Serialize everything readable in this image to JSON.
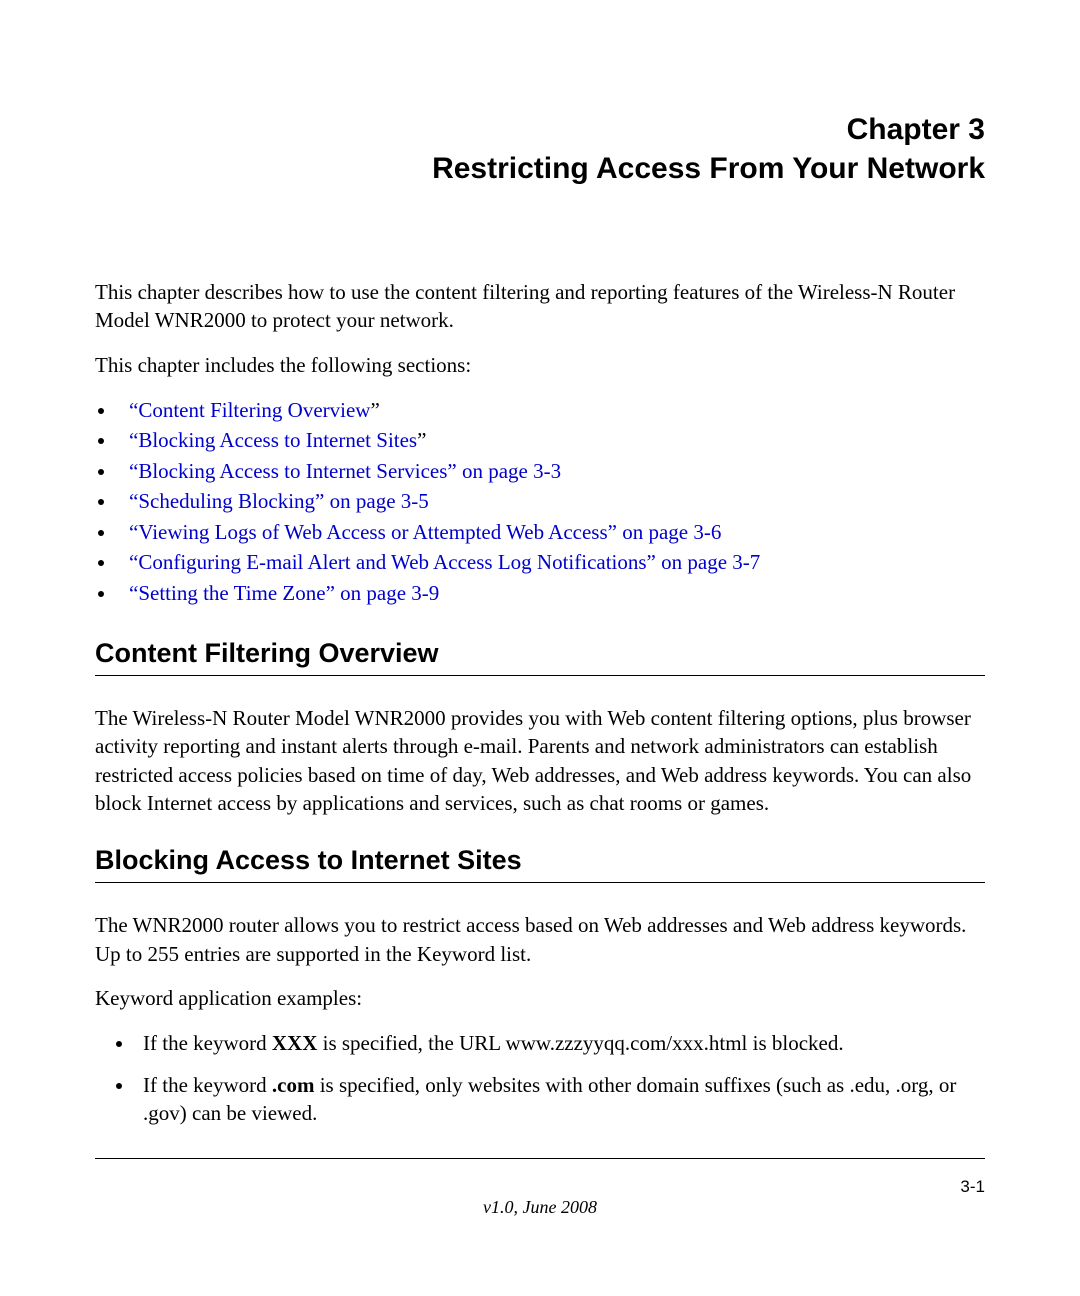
{
  "chapter": {
    "line1": "Chapter 3",
    "line2": "Restricting Access From Your Network"
  },
  "intro": {
    "p1": "This chapter describes how to use the content filtering and reporting features of the Wireless-N Router Model WNR2000 to protect your network.",
    "p2": "This chapter includes the following sections:"
  },
  "toc": [
    {
      "link": "“Content Filtering Overview",
      "tail": "”"
    },
    {
      "link": "“Blocking Access to Internet Sites",
      "tail": "”"
    },
    {
      "link": "“Blocking Access to Internet Services” on page 3-3",
      "tail": ""
    },
    {
      "link": "“Scheduling Blocking” on page 3-5",
      "tail": ""
    },
    {
      "link": "“Viewing Logs of Web Access or Attempted Web Access” on page 3-6",
      "tail": ""
    },
    {
      "link": "“Configuring E-mail Alert and Web Access Log Notifications” on page 3-7",
      "tail": ""
    },
    {
      "link": "“Setting the Time Zone” on page 3-9",
      "tail": ""
    }
  ],
  "section1": {
    "heading": "Content Filtering Overview",
    "body": "The Wireless-N Router Model WNR2000 provides you with Web content filtering options, plus browser activity reporting and instant alerts through e-mail. Parents and network administrators can establish restricted access policies based on time of day, Web addresses, and Web address keywords. You can also block Internet access by applications and services, such as chat rooms or games."
  },
  "section2": {
    "heading": "Blocking Access to Internet Sites",
    "body1": "The WNR2000 router allows you to restrict access based on Web addresses and Web address keywords. Up to 255 entries are supported in the Keyword list.",
    "body2": "Keyword application examples:",
    "bullets": [
      {
        "pre": "If the keyword ",
        "bold": "XXX",
        "post": " is specified, the URL www.zzzyyqq.com/xxx.html is blocked."
      },
      {
        "pre": "If the keyword ",
        "bold": ".com",
        "post": " is specified, only websites with other domain suffixes (such as .edu, .org, or .gov) can be viewed."
      }
    ]
  },
  "footer": {
    "page": "3-1",
    "version": "v1.0, June 2008"
  }
}
